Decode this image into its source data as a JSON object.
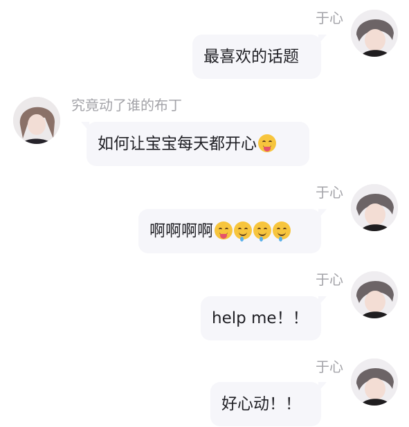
{
  "messages": [
    {
      "side": "right",
      "sender": "于心",
      "text": "最喜欢的话题"
    },
    {
      "side": "left",
      "sender": "究竟动了谁的布丁",
      "text": "如何让宝宝每天都开心"
    },
    {
      "side": "right",
      "sender": "于心",
      "text": "啊啊啊啊"
    },
    {
      "side": "right",
      "sender": "于心",
      "text": "help me！！"
    },
    {
      "side": "right",
      "sender": "于心",
      "text": "好心动！！"
    }
  ],
  "emojis": {
    "msg2": [
      "yum-face-icon"
    ],
    "msg3": [
      "squinting-tongue-icon",
      "drooling-face-icon",
      "drooling-face-icon",
      "drooling-face-icon"
    ]
  },
  "colors": {
    "bubble": "#f6f6fa",
    "sender": "#a3a3a8",
    "text": "#1f1f24"
  }
}
